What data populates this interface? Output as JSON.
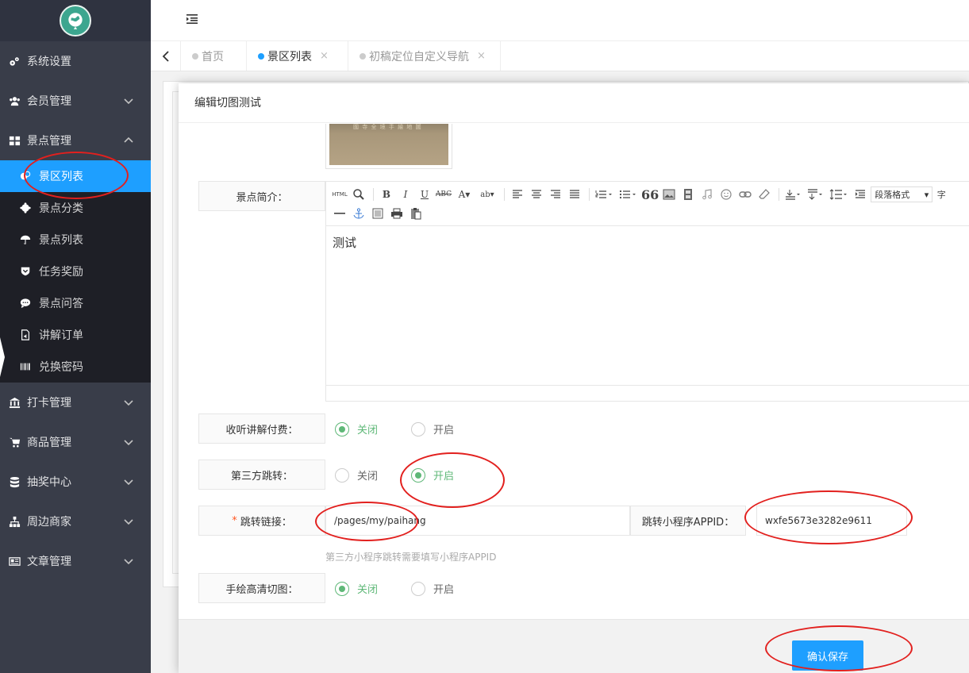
{
  "sidebar": {
    "items": [
      {
        "label": "系统设置",
        "icon": "gears-icon"
      },
      {
        "label": "会员管理",
        "icon": "users-icon"
      },
      {
        "label": "景点管理",
        "icon": "grid-icon"
      }
    ],
    "subitems": [
      {
        "label": "景区列表",
        "icon": "map-icon"
      },
      {
        "label": "景点分类",
        "icon": "gear-icon"
      },
      {
        "label": "景点列表",
        "icon": "umbrella-icon"
      },
      {
        "label": "任务奖励",
        "icon": "shield-icon"
      },
      {
        "label": "景点问答",
        "icon": "chat-icon"
      },
      {
        "label": "讲解订单",
        "icon": "audio-file-icon"
      },
      {
        "label": "兑换密码",
        "icon": "barcode-icon"
      }
    ],
    "items_after": [
      {
        "label": "打卡管理",
        "icon": "bank-icon"
      },
      {
        "label": "商品管理",
        "icon": "cart-icon"
      },
      {
        "label": "抽奖中心",
        "icon": "database-icon"
      },
      {
        "label": "周边商家",
        "icon": "sitemap-icon"
      },
      {
        "label": "文章管理",
        "icon": "newspaper-icon"
      }
    ]
  },
  "tabs": [
    {
      "label": "首页"
    },
    {
      "label": "景区列表",
      "close": "×"
    },
    {
      "label": "初稿定位自定义导航",
      "close": "×"
    }
  ],
  "modal": {
    "title": "编辑切图测试",
    "thumb_caption": "國 寺 全 境 手 繪 地 圖",
    "intro_label": "景点简介：",
    "editor": {
      "html_btn": "HTML",
      "font_select": "段落格式",
      "extra_char": "字",
      "content": "测试"
    },
    "listen_fee": {
      "label": "收听讲解付费：",
      "off": "关闭",
      "on": "开启",
      "selected": "off"
    },
    "third_party": {
      "label": "第三方跳转：",
      "off": "关闭",
      "on": "开启",
      "selected": "on"
    },
    "jump_link": {
      "required": "*",
      "label": "跳转链接：",
      "value": "/pages/my/paihang"
    },
    "appid": {
      "label": "跳转小程序APPID：",
      "value": "wxfe5673e3282e9611"
    },
    "hint": "第三方小程序跳转需要填写小程序APPID",
    "hd_map": {
      "label": "手绘高清切图：",
      "off": "关闭",
      "on": "开启",
      "selected": "off"
    },
    "save_label": "确认保存"
  },
  "colors": {
    "primary": "#1e9fff",
    "sidebar": "#393d49",
    "radio_on": "#5fb878",
    "annotation": "#e2201e"
  }
}
